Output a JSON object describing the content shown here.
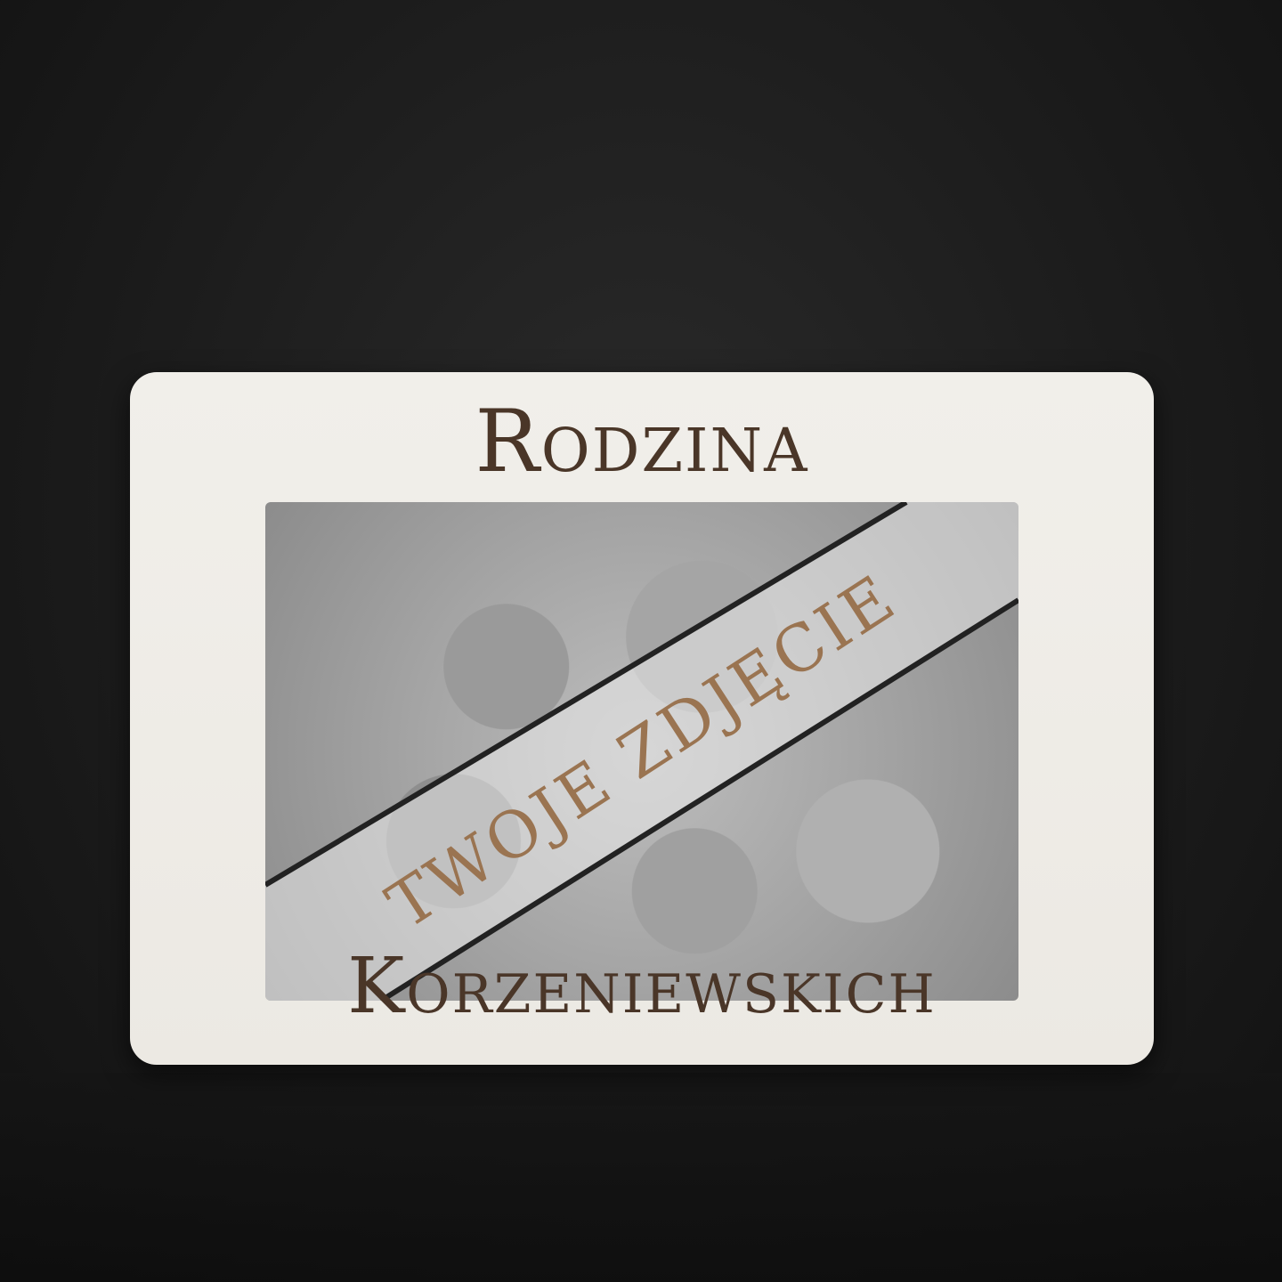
{
  "frame": {
    "title_top": "Rodzina",
    "title_bottom": "Korzeniewskich"
  },
  "photo": {
    "placeholder_label": "TWOJE ZDJĘCIE",
    "style": "grayscale family photo, faces looking down"
  },
  "colors": {
    "background": "#1b1b1b",
    "frame": "#eeebe5",
    "engraving": "#4a3628",
    "placeholder_text": "#9a7451"
  }
}
